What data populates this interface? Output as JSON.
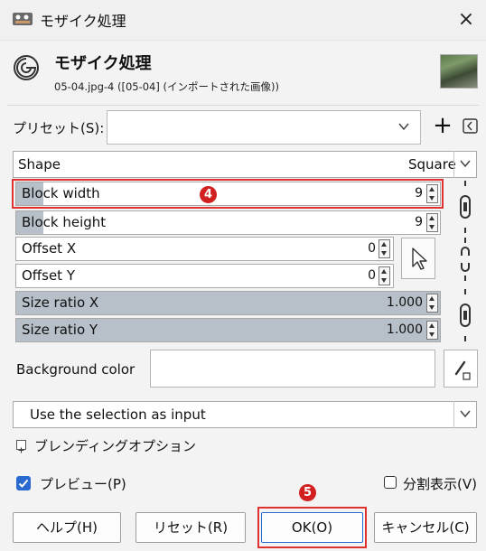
{
  "window": {
    "title": "モザイク処理",
    "close_glyph": "×"
  },
  "header": {
    "title": "モザイク処理",
    "subtitle": "05-04.jpg-4 ([05-04] (インポートされた画像))"
  },
  "presets": {
    "label": "プリセット(S):",
    "add_glyph": "+",
    "value": ""
  },
  "shape": {
    "label": "Shape",
    "value": "Square"
  },
  "fields": {
    "block_width": {
      "label": "Block width",
      "value": "9"
    },
    "block_height": {
      "label": "Block height",
      "value": "9"
    },
    "offset_x": {
      "label": "Offset X",
      "value": "0"
    },
    "offset_y": {
      "label": "Offset Y",
      "value": "0"
    },
    "size_ratio_x": {
      "label": "Size ratio X",
      "value": "1.000"
    },
    "size_ratio_y": {
      "label": "Size ratio Y",
      "value": "1.000"
    }
  },
  "background_color": {
    "label": "Background color",
    "value": "#ffffff"
  },
  "input_mode": {
    "value": "Use the selection as input"
  },
  "blending": {
    "label": "ブレンディングオプション"
  },
  "preview": {
    "label": "プレビュー(P)",
    "checked": true
  },
  "split_view": {
    "label": "分割表示(V)",
    "checked": false
  },
  "buttons": {
    "help": "ヘルプ(H)",
    "reset": "リセット(R)",
    "ok": "OK(O)",
    "cancel": "キャンセル(C)"
  },
  "annotations": {
    "step4": "4",
    "step5": "5"
  },
  "colors": {
    "highlight": "#e03030",
    "badge": "#d21f1f",
    "accent": "#2a6ad0",
    "ratio_fill": "#b7c0c8"
  }
}
